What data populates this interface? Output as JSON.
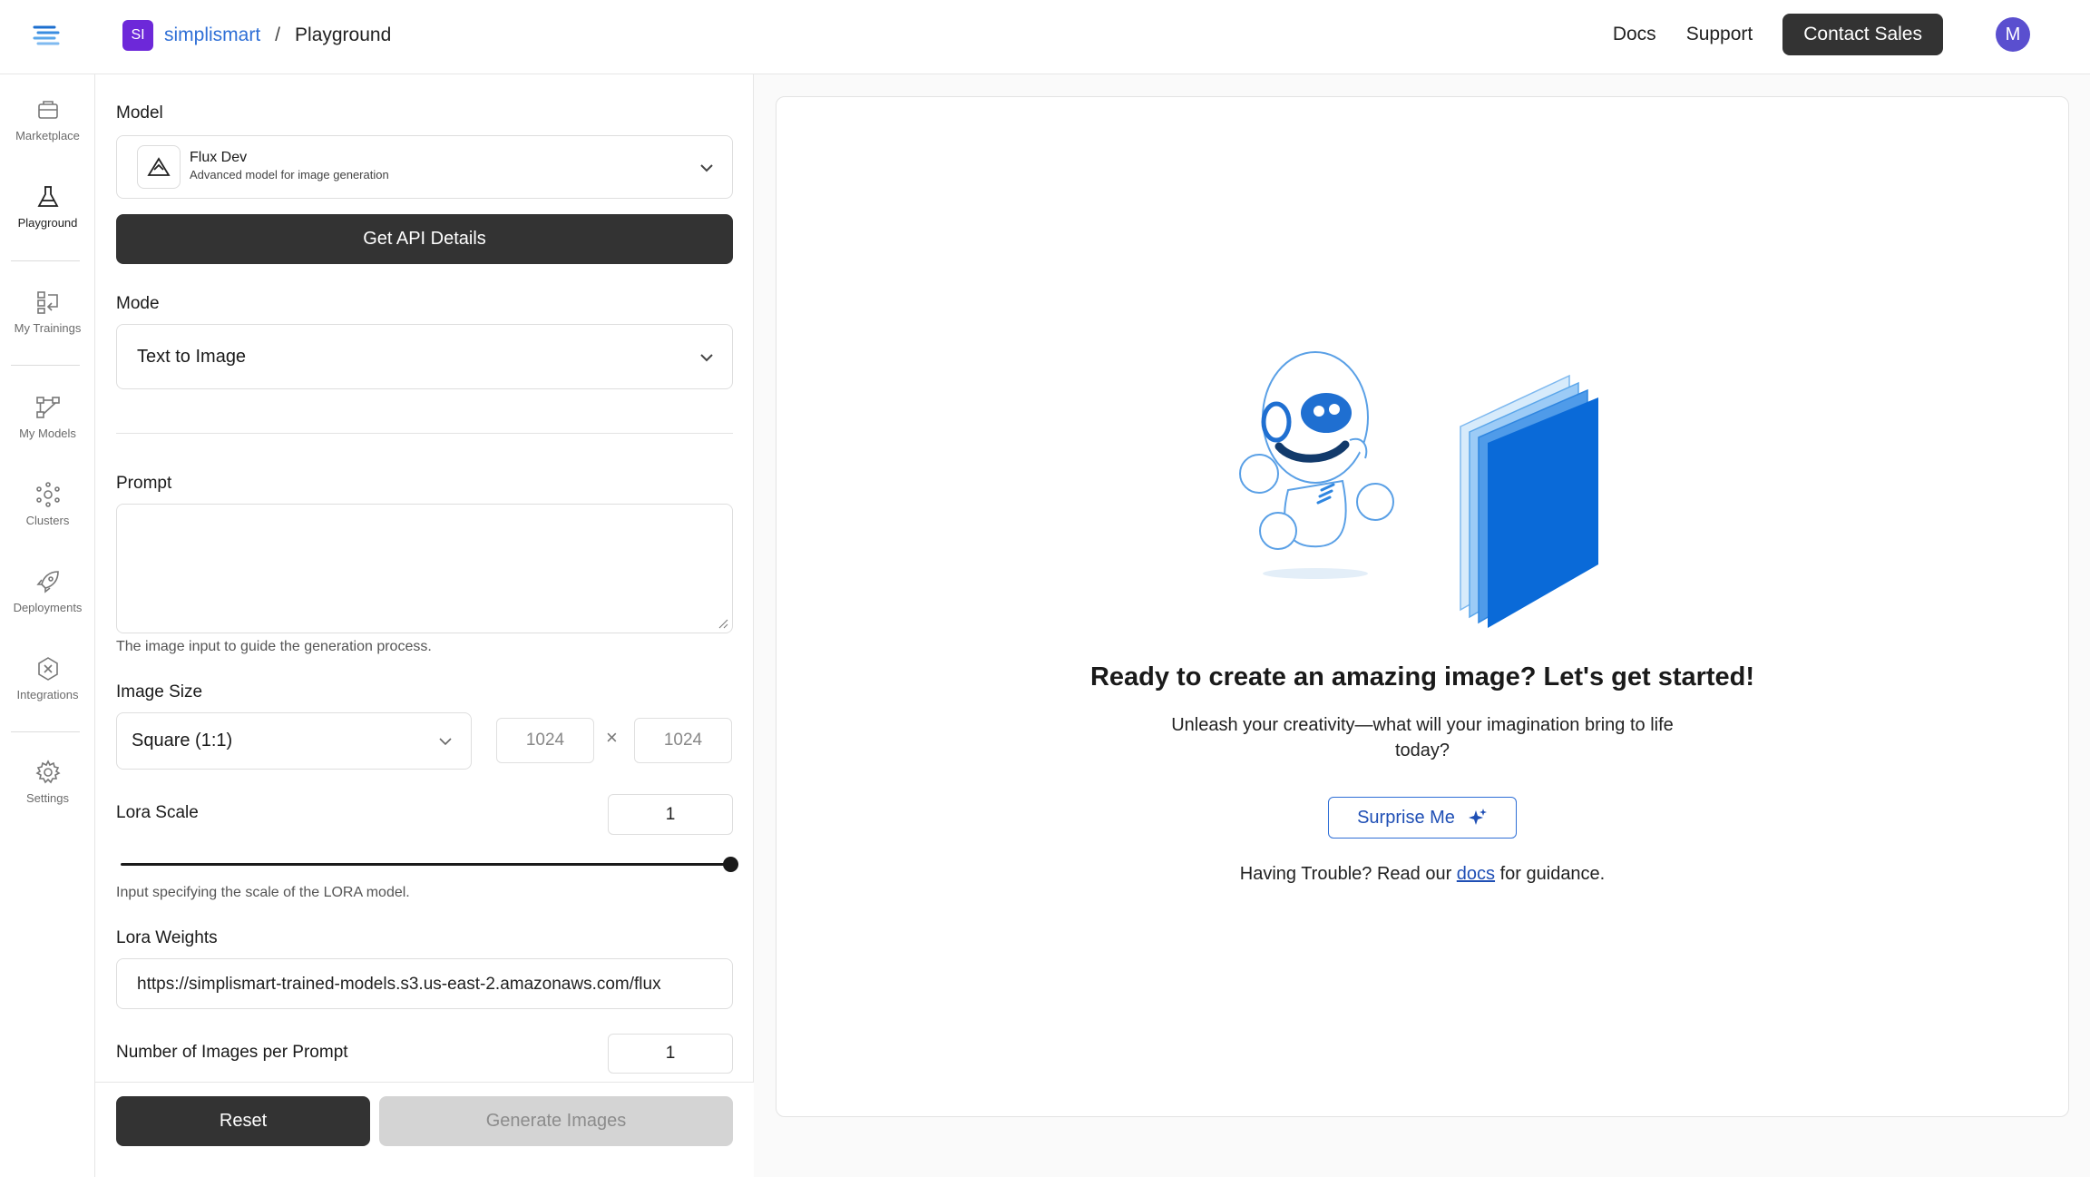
{
  "header": {
    "org_badge": "SI",
    "org_name": "simplismart",
    "separator": "/",
    "page": "Playground",
    "links": [
      "Docs",
      "Support"
    ],
    "contact_label": "Contact Sales",
    "avatar_initial": "M"
  },
  "sidebar": {
    "items": [
      {
        "label": "Marketplace",
        "icon": "marketplace-icon"
      },
      {
        "label": "Playground",
        "icon": "flask-icon",
        "active": true
      },
      {
        "label": "My Trainings",
        "icon": "trainings-icon"
      },
      {
        "label": "My Models",
        "icon": "models-icon"
      },
      {
        "label": "Clusters",
        "icon": "clusters-icon"
      },
      {
        "label": "Deployments",
        "icon": "rocket-icon"
      },
      {
        "label": "Integrations",
        "icon": "integrations-icon"
      },
      {
        "label": "Settings",
        "icon": "gear-icon"
      }
    ]
  },
  "form": {
    "model_label": "Model",
    "model_name": "Flux Dev",
    "model_desc": "Advanced model for image generation",
    "api_button": "Get API Details",
    "mode_label": "Mode",
    "mode_value": "Text to Image",
    "prompt_label": "Prompt",
    "prompt_hint": "The image input to guide the generation process.",
    "image_size_label": "Image Size",
    "image_size_value": "Square (1:1)",
    "width": "1024",
    "times": "×",
    "height": "1024",
    "lora_scale_label": "Lora Scale",
    "lora_scale_value": "1",
    "lora_scale_fraction": 1.0,
    "lora_scale_hint": "Input specifying the scale of the LORA model.",
    "lora_weights_label": "Lora Weights",
    "lora_weights_value": "https://simplismart-trained-models.s3.us-east-2.amazonaws.com/flux",
    "num_images_label": "Number of Images per Prompt",
    "num_images_value": "1",
    "reset_button": "Reset",
    "generate_button": "Generate Images"
  },
  "hero": {
    "title": "Ready to create an amazing image? Let's get started!",
    "subtitle": "Unleash your creativity—what will your imagination bring to life today?",
    "surprise_button": "Surprise Me",
    "trouble_prefix": "Having Trouble? Read our ",
    "trouble_link": "docs",
    "trouble_suffix": " for guidance."
  },
  "colors": {
    "accent": "#2f6fd6",
    "dark_button": "#333333",
    "org_badge": "#6d28d9",
    "avatar": "#5a4fcf"
  }
}
